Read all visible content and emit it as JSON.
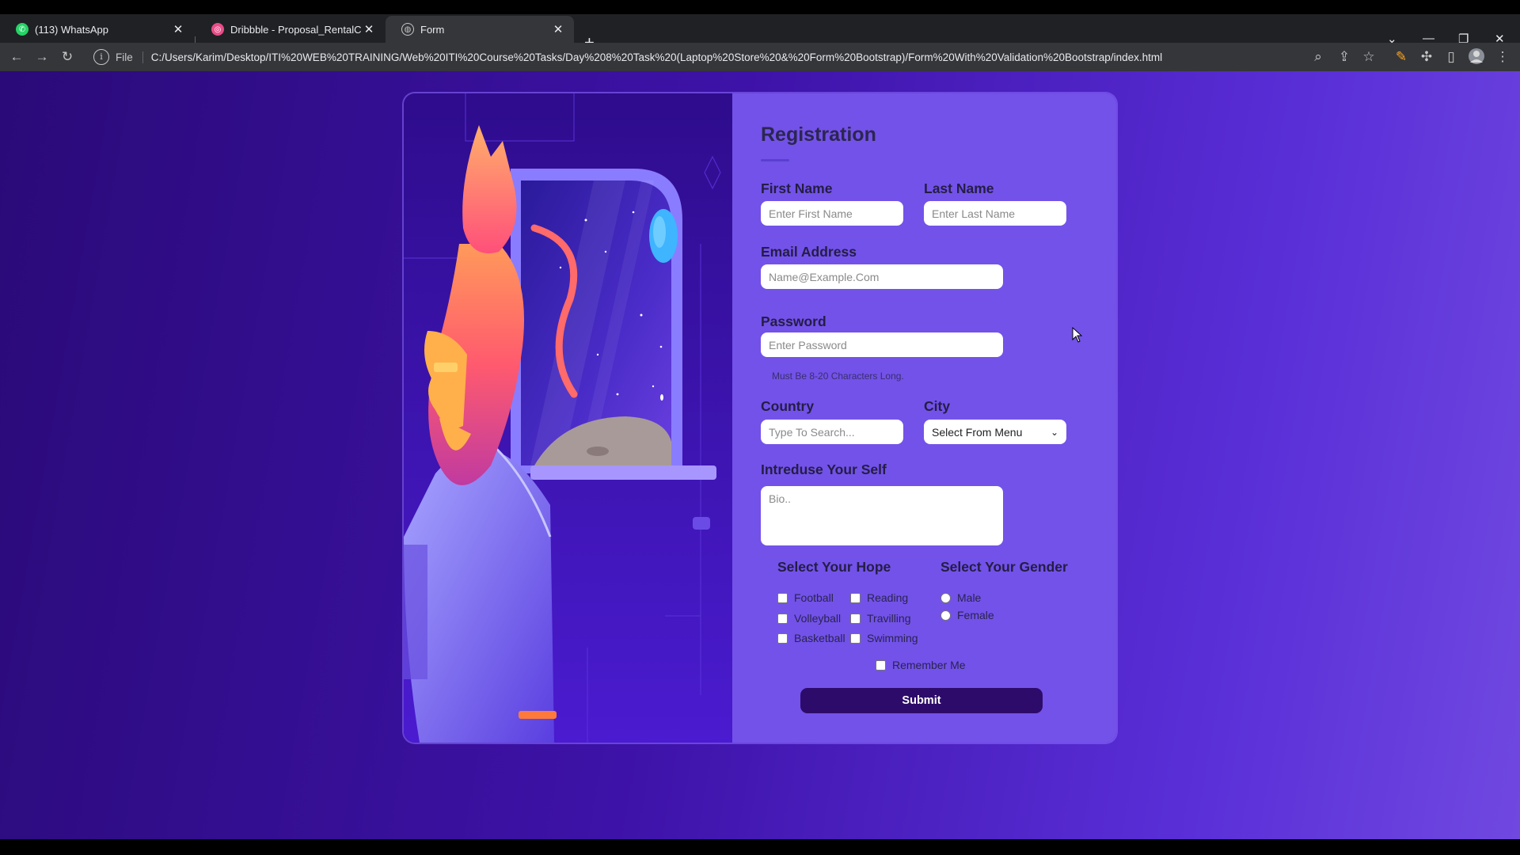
{
  "browser": {
    "tabs": [
      {
        "title": "(113) WhatsApp",
        "favicon": "whatsapp-icon",
        "color": "#25d366"
      },
      {
        "title": "Dribbble - Proposal_RentalCar.pn",
        "favicon": "dribbble-icon",
        "color": "#ea4c89"
      },
      {
        "title": "Form",
        "favicon": "globe-icon",
        "color": "#9aa0a6"
      }
    ],
    "address": {
      "scheme_label": "File",
      "url": "C:/Users/Karim/Desktop/ITI%20WEB%20TRAINING/Web%20ITI%20Course%20Tasks/Day%208%20Task%20(Laptop%20Store%20&%20Form%20Bootstrap)/Form%20With%20Validation%20Bootstrap/index.html"
    }
  },
  "form": {
    "title": "Registration",
    "first_name": {
      "label": "First Name",
      "placeholder": "Enter First Name"
    },
    "last_name": {
      "label": "Last Name",
      "placeholder": "Enter Last Name"
    },
    "email": {
      "label": "Email Address",
      "placeholder": "Name@Example.Com"
    },
    "password": {
      "label": "Password",
      "placeholder": "Enter Password",
      "helper": "Must Be 8-20 Characters Long."
    },
    "country": {
      "label": "Country",
      "placeholder": "Type To Search..."
    },
    "city": {
      "label": "City",
      "selected": "Select From Menu"
    },
    "bio": {
      "label": "Intreduse Your Self",
      "placeholder": "Bio.."
    },
    "hope": {
      "label": "Select Your Hope",
      "options": [
        "Football",
        "Reading",
        "Volleyball",
        "Travilling",
        "Basketball",
        "Swimming"
      ]
    },
    "gender": {
      "label": "Select Your Gender",
      "options": [
        "Male",
        "Female"
      ]
    },
    "remember_me": "Remember Me",
    "submit_label": "Submit"
  },
  "colors": {
    "panel": "#7352e9",
    "submit": "#2d0b6a",
    "background_start": "#2a0a78",
    "background_end": "#7048e0"
  }
}
